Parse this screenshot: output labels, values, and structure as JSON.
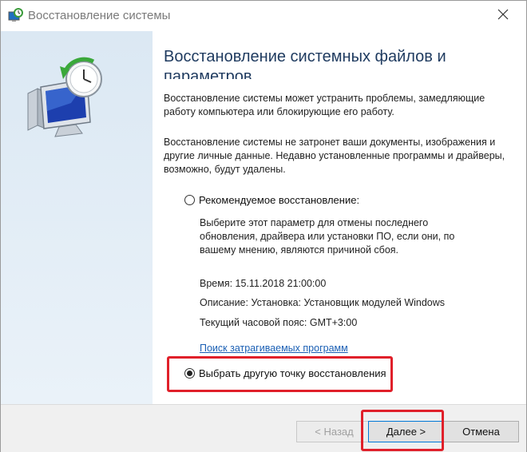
{
  "window": {
    "title": "Восстановление системы",
    "close_glyph": "✕"
  },
  "content": {
    "heading_line1": "Восстановление системных файлов и",
    "heading_line2": "параметров",
    "intro": "Восстановление системы может устранить проблемы, замедляющие работу компьютера или блокирующие его работу.",
    "notice": "Восстановление системы не затронет ваши документы, изображения и другие личные данные. Недавно установленные программы и драйверы, возможно, будут удалены.",
    "recommended": {
      "label": "Рекомендуемое восстановление:",
      "checked": false,
      "description": "Выберите этот параметр для отмены последнего обновления, драйвера или установки ПО, если они, по вашему мнению, являются причиной сбоя.",
      "time": "Время: 15.11.2018 21:00:00",
      "description_line": "Описание: Установка: Установщик модулей Windows",
      "timezone": "Текущий часовой пояс: GMT+3:00",
      "link": "Поиск затрагиваемых программ"
    },
    "choose_other": {
      "label": "Выбрать другую точку восстановления",
      "checked": true
    }
  },
  "footer": {
    "back_label": "< Назад",
    "next_label": "Далее >",
    "cancel_label": "Отмена"
  },
  "colors": {
    "highlight": "#e0202a",
    "link": "#1a5fb4",
    "heading": "#1e3a5f"
  },
  "icons": {
    "app": "system-restore-icon",
    "hero": "computer-restore-clock-icon",
    "close": "close-icon"
  }
}
